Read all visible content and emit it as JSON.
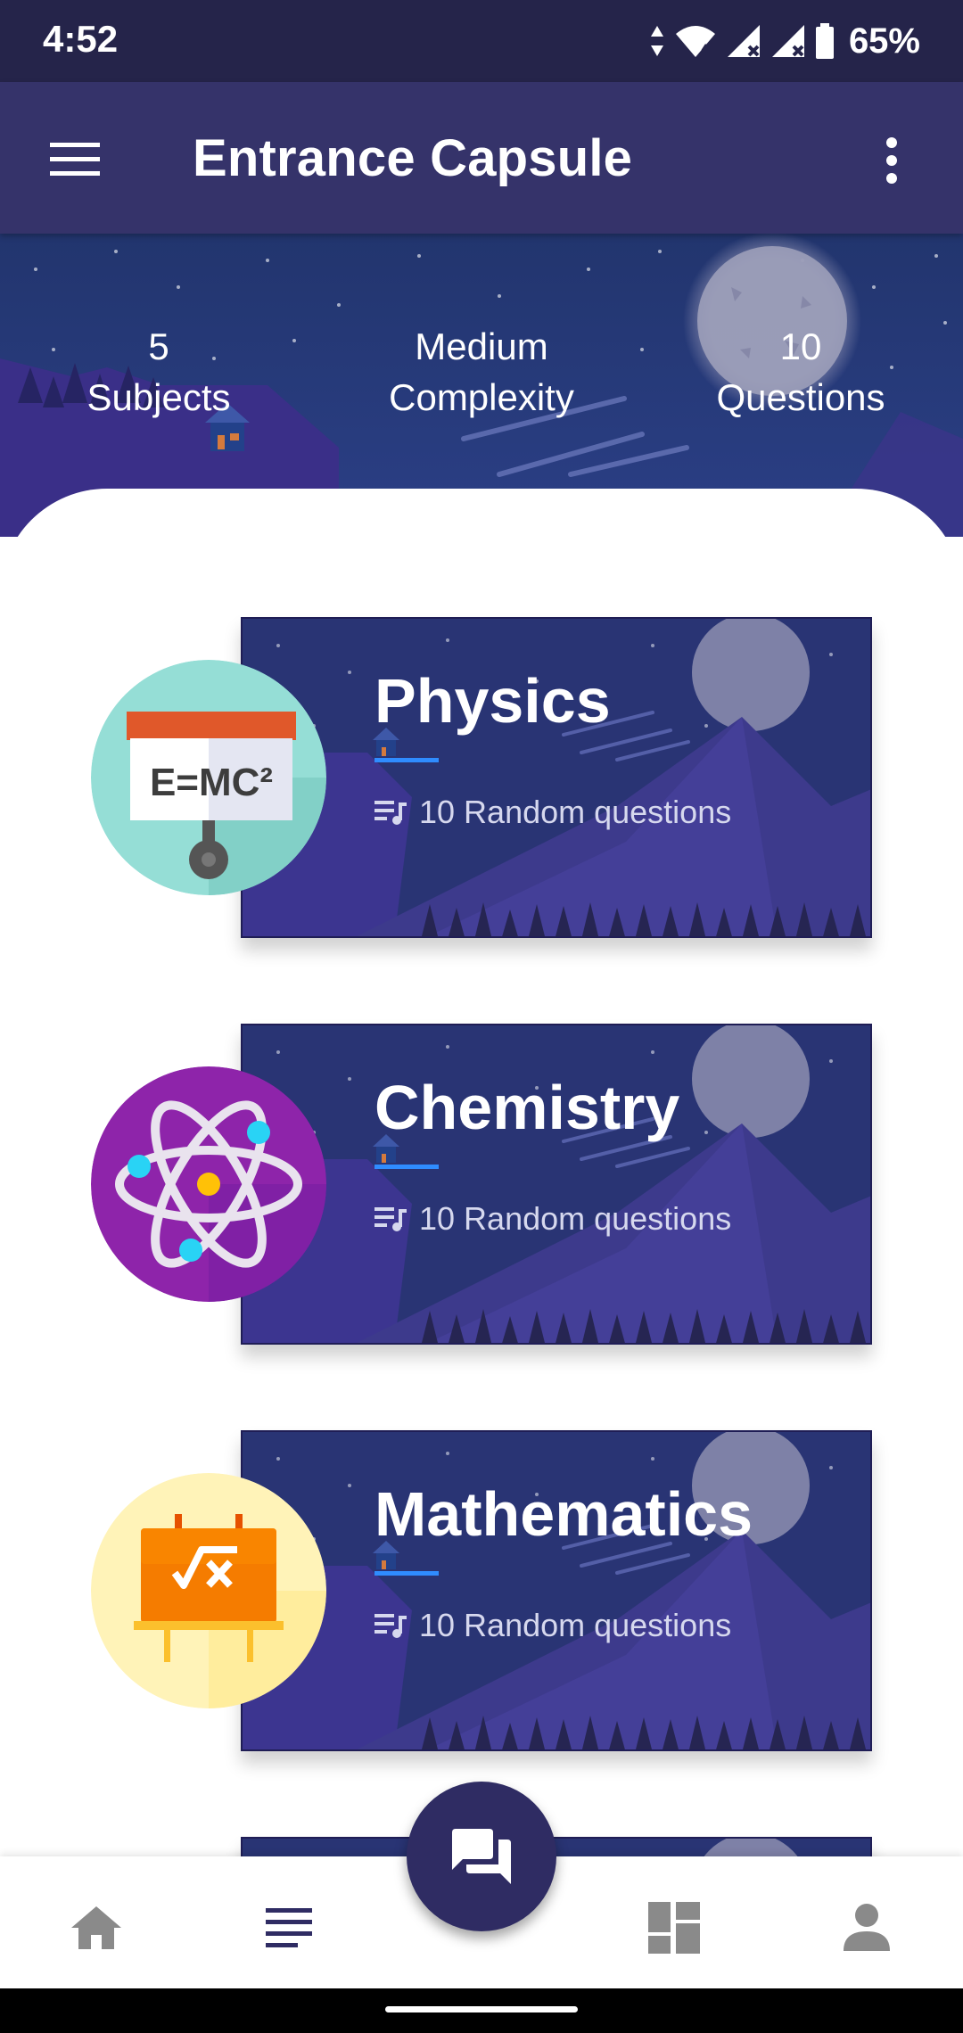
{
  "status_bar": {
    "time": "4:52",
    "battery": "65%",
    "icons": [
      "data-arrows-icon",
      "wifi-icon",
      "signal-icon",
      "signal-icon",
      "battery-icon"
    ]
  },
  "app_bar": {
    "title": "Entrance Capsule",
    "menu_icon": "hamburger-menu-icon",
    "more_icon": "more-vert-icon"
  },
  "stats": [
    {
      "value": "5",
      "label": "Subjects"
    },
    {
      "value": "Medium",
      "label": "Complexity"
    },
    {
      "value": "10",
      "label": "Questions"
    }
  ],
  "subjects": [
    {
      "name": "Physics",
      "subtitle": "10 Random questions",
      "icon": "physics-emc2-icon",
      "icon_bg": "#95ded6"
    },
    {
      "name": "Chemistry",
      "subtitle": "10 Random questions",
      "icon": "atom-icon",
      "icon_bg": "#8e24aa"
    },
    {
      "name": "Mathematics",
      "subtitle": "10 Random questions",
      "icon": "math-board-icon",
      "icon_bg": "#fff3b8"
    }
  ],
  "bottom_nav": {
    "items": [
      "home-icon",
      "list-icon",
      "chat-icon",
      "dashboard-icon",
      "person-icon"
    ],
    "active_color": "#2f2c63",
    "inactive_color": "#8a8a8a"
  },
  "colors": {
    "app_bar": "#35336a",
    "status_bar": "#25244a",
    "card_bg": "#2a2f78",
    "accent": "#2f8cff"
  }
}
